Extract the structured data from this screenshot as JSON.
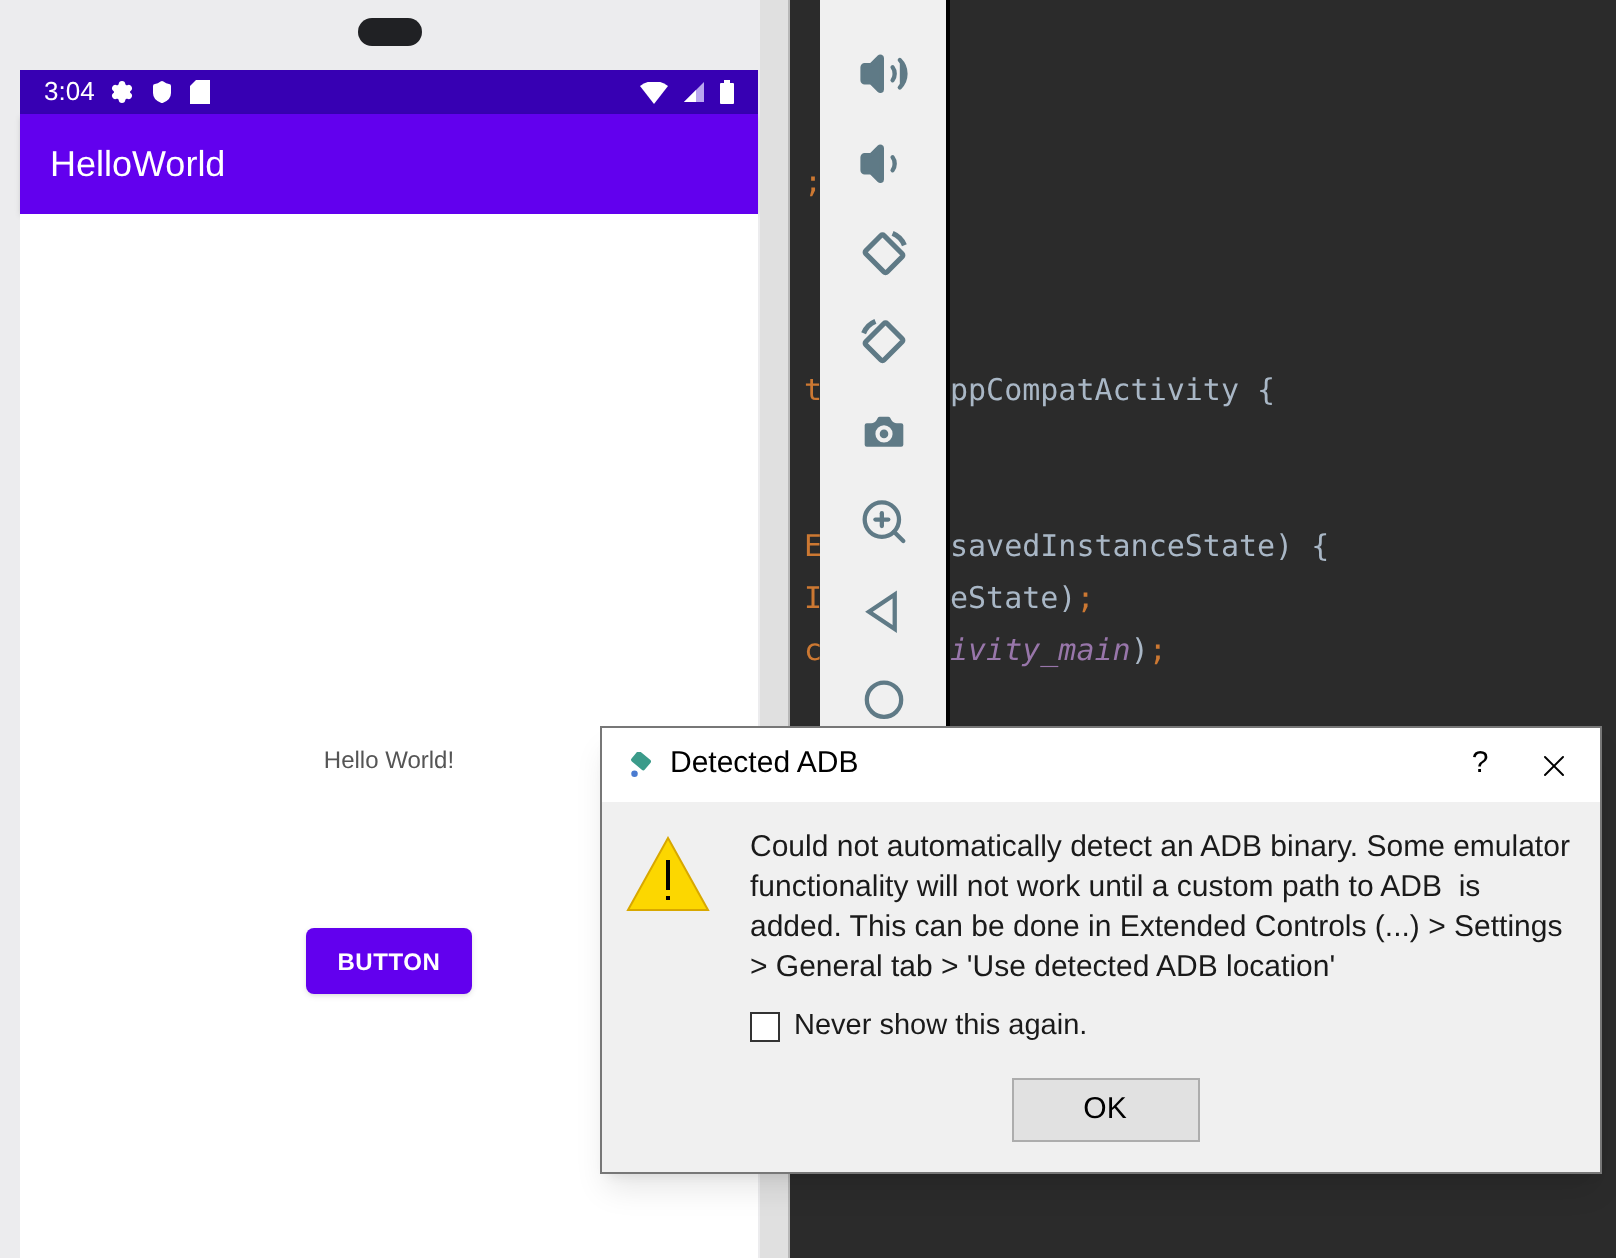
{
  "phone": {
    "status_bar": {
      "time": "3:04"
    },
    "app_bar": {
      "title": "HelloWorld"
    },
    "content": {
      "text": "Hello World!",
      "button": "BUTTON"
    }
  },
  "editor": {
    "lines": [
      {
        "kind": "blank"
      },
      {
        "kind": "blank"
      },
      {
        "kind": "blank"
      },
      {
        "kind": "code",
        "gutter": ";"
      },
      {
        "kind": "blank"
      },
      {
        "kind": "blank"
      },
      {
        "kind": "blank"
      },
      {
        "kind": "code",
        "gutter": "t",
        "segments": [
          {
            "kind": "plain",
            "text": "ppCompatActivity {"
          }
        ]
      },
      {
        "kind": "blank"
      },
      {
        "kind": "blank"
      },
      {
        "kind": "code",
        "gutter": "E",
        "segments": [
          {
            "kind": "plain",
            "text": "savedInstanceState) {"
          }
        ]
      },
      {
        "kind": "code",
        "gutter": "I",
        "segments": [
          {
            "kind": "plain",
            "text": "eState)"
          },
          {
            "kind": "keyword",
            "text": ";"
          }
        ]
      },
      {
        "kind": "code",
        "gutter": "c",
        "segments": [
          {
            "kind": "field",
            "text": "ivity_main"
          },
          {
            "kind": "plain",
            "text": ")"
          },
          {
            "kind": "keyword",
            "text": ";"
          }
        ]
      }
    ]
  },
  "dialog": {
    "title": "Detected ADB",
    "help": "?",
    "message": "Could not automatically detect an ADB binary. Some emulator functionality will not work until a custom path to ADB  is added. This can be done in Extended Controls (...) > Settings > General tab > 'Use detected ADB location'",
    "checkbox": {
      "label": "Never show this again.",
      "checked": false
    },
    "ok": "OK"
  }
}
